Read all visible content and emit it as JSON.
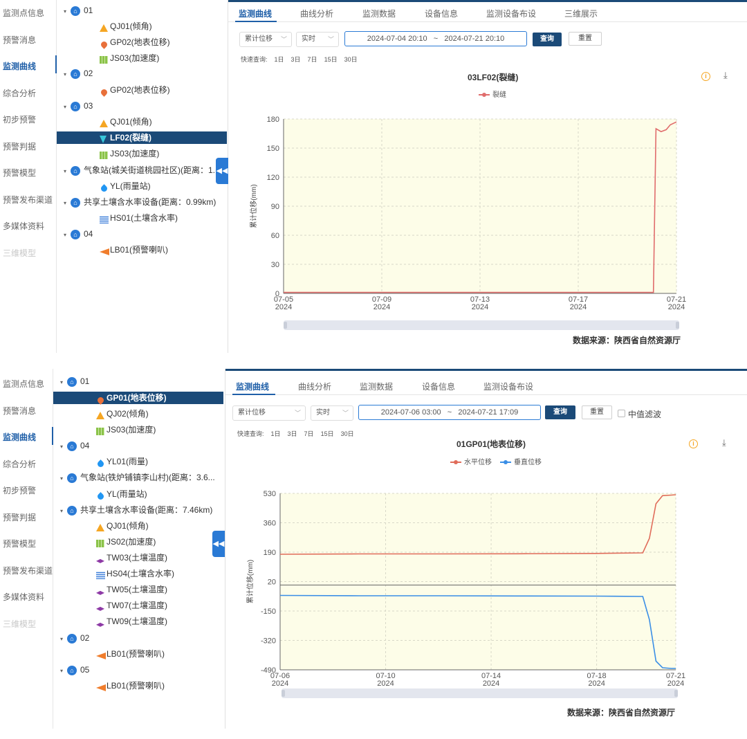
{
  "panel_a": {
    "menu": [
      {
        "label": "监测点信息",
        "state": "normal"
      },
      {
        "label": "预警消息",
        "state": "normal"
      },
      {
        "label": "监测曲线",
        "state": "active"
      },
      {
        "label": "综合分析",
        "state": "normal"
      },
      {
        "label": "初步预警",
        "state": "normal"
      },
      {
        "label": "预警判据",
        "state": "normal"
      },
      {
        "label": "预警模型",
        "state": "normal"
      },
      {
        "label": "预警发布渠道",
        "state": "normal"
      },
      {
        "label": "多媒体资料",
        "state": "normal"
      },
      {
        "label": "三维模型",
        "state": "disabled"
      }
    ],
    "tree": [
      {
        "type": "group",
        "label": "01"
      },
      {
        "type": "device",
        "icon": "triangle-icon",
        "label": "QJ01(倾角)"
      },
      {
        "type": "device",
        "icon": "pin-icon",
        "label": "GP02(地表位移)"
      },
      {
        "type": "device",
        "icon": "accelerometer-icon",
        "label": "JS03(加速度)"
      },
      {
        "type": "group",
        "label": "02"
      },
      {
        "type": "device",
        "icon": "pin-icon",
        "label": "GP02(地表位移)"
      },
      {
        "type": "group",
        "label": "03"
      },
      {
        "type": "device",
        "icon": "triangle-icon",
        "label": "QJ01(倾角)"
      },
      {
        "type": "device",
        "icon": "crack-icon",
        "label": "LF02(裂缝)",
        "selected": true
      },
      {
        "type": "device",
        "icon": "accelerometer-icon",
        "label": "JS03(加速度)"
      },
      {
        "type": "group",
        "label": "气象站(城关街道桃园社区)(距离：1."
      },
      {
        "type": "device",
        "icon": "raindrop-icon",
        "label": "YL(雨量站)"
      },
      {
        "type": "group",
        "label": "共享土壤含水率设备(距离：0.99km)"
      },
      {
        "type": "device",
        "icon": "soil-moisture-icon",
        "label": "HS01(土壤含水率)"
      },
      {
        "type": "group",
        "label": "04"
      },
      {
        "type": "device",
        "icon": "horn-icon",
        "label": "LB01(预警喇叭)"
      }
    ],
    "collapse_icon": "double-chevron-left-icon",
    "tabs": [
      "监测曲线",
      "曲线分析",
      "监测数据",
      "设备信息",
      "监测设备布设",
      "三维展示"
    ],
    "active_tab": "监测曲线",
    "filters": {
      "type_select": "累计位移",
      "mode_select": "实时",
      "range_start": "2024-07-04 20:10",
      "range_sep": "~",
      "range_end": "2024-07-21 20:10",
      "query_label": "查询",
      "reset_label": "重置"
    },
    "quick_query": {
      "label": "快速查询:",
      "options": [
        "1日",
        "3日",
        "7日",
        "15日",
        "30日"
      ]
    },
    "info_icon": "info-icon",
    "download_icon": "download-icon",
    "source": "数据来源：陕西省自然资源厅",
    "colors": {
      "series": "#e06c6c",
      "plot_bg": "#fdfde8",
      "accent": "#1b4a78"
    }
  },
  "panel_b": {
    "menu": [
      {
        "label": "监测点信息",
        "state": "normal"
      },
      {
        "label": "预警消息",
        "state": "normal"
      },
      {
        "label": "监测曲线",
        "state": "active"
      },
      {
        "label": "综合分析",
        "state": "normal"
      },
      {
        "label": "初步预警",
        "state": "normal"
      },
      {
        "label": "预警判据",
        "state": "normal"
      },
      {
        "label": "预警模型",
        "state": "normal"
      },
      {
        "label": "预警发布渠道",
        "state": "normal"
      },
      {
        "label": "多媒体资料",
        "state": "normal"
      },
      {
        "label": "三维模型",
        "state": "disabled"
      }
    ],
    "tree": [
      {
        "type": "group",
        "label": "01"
      },
      {
        "type": "device",
        "icon": "pin-icon",
        "label": "GP01(地表位移)",
        "selected": true
      },
      {
        "type": "device",
        "icon": "triangle-icon",
        "label": "QJ02(倾角)"
      },
      {
        "type": "device",
        "icon": "accelerometer-icon",
        "label": "JS03(加速度)"
      },
      {
        "type": "group",
        "label": "04"
      },
      {
        "type": "device",
        "icon": "raindrop-icon",
        "label": "YL01(雨量)"
      },
      {
        "type": "group",
        "label": "气象站(铁炉铺镇李山村)(距离：3.6..."
      },
      {
        "type": "device",
        "icon": "raindrop-icon",
        "label": "YL(雨量站)"
      },
      {
        "type": "group",
        "label": "共享土壤含水率设备(距离：7.46km)"
      },
      {
        "type": "device",
        "icon": "triangle-icon",
        "label": "QJ01(倾角)"
      },
      {
        "type": "device",
        "icon": "accelerometer-icon",
        "label": "JS02(加速度)"
      },
      {
        "type": "device",
        "icon": "soil-temperature-icon",
        "label": "TW03(土壤温度)"
      },
      {
        "type": "device",
        "icon": "soil-moisture-icon",
        "label": "HS04(土壤含水率)"
      },
      {
        "type": "device",
        "icon": "soil-temperature-icon",
        "label": "TW05(土壤温度)"
      },
      {
        "type": "device",
        "icon": "soil-temperature-icon",
        "label": "TW07(土壤温度)"
      },
      {
        "type": "device",
        "icon": "soil-temperature-icon",
        "label": "TW09(土壤温度)"
      },
      {
        "type": "group",
        "label": "02"
      },
      {
        "type": "device",
        "icon": "horn-icon",
        "label": "LB01(预警喇叭)"
      },
      {
        "type": "group",
        "label": "05"
      },
      {
        "type": "device",
        "icon": "horn-icon",
        "label": "LB01(预警喇叭)"
      }
    ],
    "collapse_icon": "double-chevron-left-icon",
    "tabs": [
      "监测曲线",
      "曲线分析",
      "监测数据",
      "设备信息",
      "监测设备布设"
    ],
    "active_tab": "监测曲线",
    "filters": {
      "type_select": "累计位移",
      "mode_select": "实时",
      "range_start": "2024-07-06 03:00",
      "range_sep": "~",
      "range_end": "2024-07-21 17:09",
      "query_label": "查询",
      "reset_label": "重置",
      "median_filter_label": "中值滤波",
      "median_filter_checked": false
    },
    "quick_query": {
      "label": "快速查询:",
      "options": [
        "1日",
        "3日",
        "7日",
        "15日",
        "30日"
      ]
    },
    "info_icon": "info-icon",
    "download_icon": "download-icon",
    "source": "数据来源：陕西省自然资源厅",
    "colors": {
      "series_1": "#e06c5a",
      "series_2": "#3a8ee6",
      "plot_bg": "#fdfde8",
      "accent": "#1b4a78"
    }
  },
  "chart_data": [
    {
      "type": "line",
      "title": "03LF02(裂缝)",
      "ylabel": "累计位移(mm)",
      "xlabel": "",
      "legend": "top-center",
      "grid": true,
      "x_ticks": [
        "07-05\n2024",
        "07-09\n2024",
        "07-13\n2024",
        "07-17\n2024",
        "07-21\n2024"
      ],
      "y_ticks": [
        0,
        30,
        60,
        90,
        120,
        150,
        180
      ],
      "ylim": [
        0,
        180
      ],
      "xlim": [
        "2024-07-05",
        "2024-07-21"
      ],
      "series": [
        {
          "name": "裂缝",
          "points": [
            [
              "2024-07-05",
              1
            ],
            [
              "2024-07-08",
              1
            ],
            [
              "2024-07-11",
              1
            ],
            [
              "2024-07-14",
              1
            ],
            [
              "2024-07-17",
              1
            ],
            [
              "2024-07-19",
              1
            ],
            [
              "2024-07-20 00:00",
              1
            ],
            [
              "2024-07-20 01:30",
              1
            ],
            [
              "2024-07-20 04:00",
              170
            ],
            [
              "2024-07-20 09:00",
              167
            ],
            [
              "2024-07-20 14:00",
              169
            ],
            [
              "2024-07-20 18:00",
              174
            ],
            [
              "2024-07-21",
              177
            ]
          ]
        }
      ]
    },
    {
      "type": "line",
      "title": "01GP01(地表位移)",
      "ylabel": "累计位移(mm)",
      "xlabel": "",
      "legend": "top-center",
      "grid": true,
      "x_ticks": [
        "07-06\n2024",
        "07-10\n2024",
        "07-14\n2024",
        "07-18\n2024",
        "07-21\n2024"
      ],
      "y_ticks": [
        -490,
        -320,
        -150,
        20,
        190,
        360,
        530
      ],
      "ylim": [
        -490,
        530
      ],
      "xlim": [
        "2024-07-06",
        "2024-07-21"
      ],
      "series": [
        {
          "name": "水平位移",
          "points": [
            [
              "2024-07-06",
              178
            ],
            [
              "2024-07-09",
              180
            ],
            [
              "2024-07-12",
              180
            ],
            [
              "2024-07-15",
              181
            ],
            [
              "2024-07-18",
              183
            ],
            [
              "2024-07-19 18:00",
              186
            ],
            [
              "2024-07-20 00:00",
              270
            ],
            [
              "2024-07-20 06:00",
              470
            ],
            [
              "2024-07-20 12:00",
              517
            ],
            [
              "2024-07-20 20:00",
              520
            ],
            [
              "2024-07-21",
              522
            ]
          ]
        },
        {
          "name": "垂直位移",
          "points": [
            [
              "2024-07-06",
              -60
            ],
            [
              "2024-07-09",
              -62
            ],
            [
              "2024-07-12",
              -62
            ],
            [
              "2024-07-15",
              -63
            ],
            [
              "2024-07-18",
              -64
            ],
            [
              "2024-07-19 18:00",
              -66
            ],
            [
              "2024-07-20 00:00",
              -200
            ],
            [
              "2024-07-20 06:00",
              -440
            ],
            [
              "2024-07-20 12:00",
              -478
            ],
            [
              "2024-07-20 20:00",
              -482
            ],
            [
              "2024-07-21",
              -482
            ]
          ]
        }
      ]
    }
  ]
}
